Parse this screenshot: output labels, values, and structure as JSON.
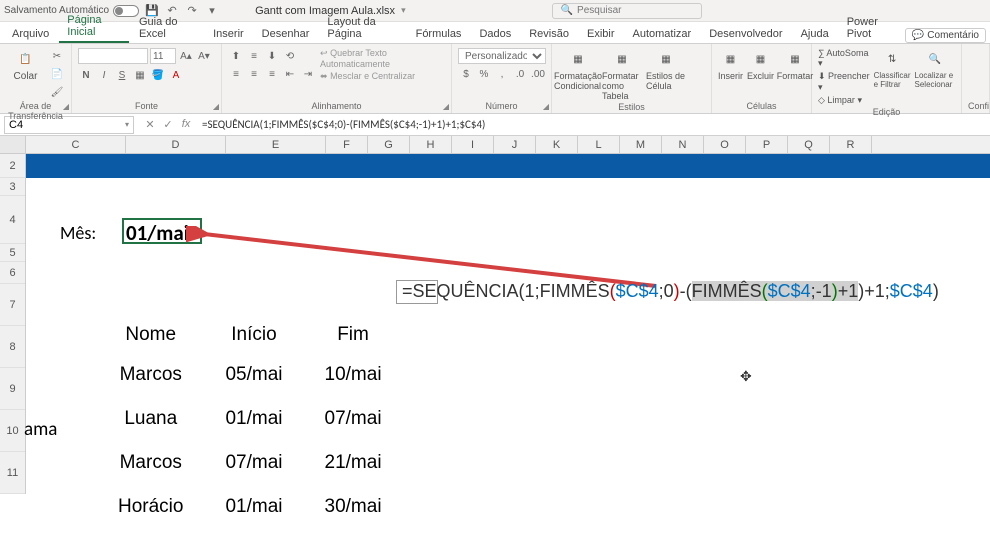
{
  "titlebar": {
    "autosave": "Salvamento Automático",
    "filename": "Gantt com Imagem Aula.xlsx",
    "search_placeholder": "Pesquisar"
  },
  "tabs": {
    "file": "Arquivo",
    "home": "Página Inicial",
    "excel_guide": "Guia do Excel",
    "insert": "Inserir",
    "draw": "Desenhar",
    "page_layout": "Layout da Página",
    "formulas": "Fórmulas",
    "data": "Dados",
    "review": "Revisão",
    "view": "Exibir",
    "automate": "Automatizar",
    "developer": "Desenvolvedor",
    "help": "Ajuda",
    "power_pivot": "Power Pivot",
    "comments": "Comentário"
  },
  "ribbon": {
    "clipboard": {
      "paste": "Colar",
      "group": "Área de Transferência"
    },
    "font": {
      "group": "Fonte",
      "size": "11"
    },
    "alignment": {
      "wrap": "Quebrar Texto Automaticamente",
      "merge": "Mesclar e Centralizar",
      "group": "Alinhamento"
    },
    "number": {
      "format": "Personalizado",
      "group": "Número"
    },
    "styles": {
      "cond": "Formatação Condicional",
      "table": "Formatar como Tabela",
      "cell": "Estilos de Célula",
      "group": "Estilos"
    },
    "cells": {
      "insert": "Inserir",
      "delete": "Excluir",
      "format": "Formatar",
      "group": "Células"
    },
    "editing": {
      "autosum": "AutoSoma",
      "fill": "Preencher",
      "clear": "Limpar",
      "sort": "Classificar e Filtrar",
      "find": "Localizar e Selecionar",
      "group": "Edição"
    },
    "conf": {
      "group": "Confi"
    }
  },
  "formula_bar": {
    "name_box": "C4",
    "formula": "=SEQUÊNCIA(1;FIMMÊS($C$4;0)-(FIMMÊS($C$4;-1)+1)+1;$C$4)"
  },
  "columns": [
    "C",
    "D",
    "E",
    "F",
    "G",
    "H",
    "I",
    "J",
    "K",
    "L",
    "M",
    "N",
    "O",
    "P",
    "Q",
    "R"
  ],
  "row_numbers": [
    "2",
    "3",
    "4",
    "5",
    "6",
    "7",
    "8",
    "9",
    "10",
    "11"
  ],
  "sheet": {
    "mes_label": "Mês:",
    "mes_value": "01/mai",
    "ama": "ama",
    "table_headers": [
      "Nome",
      "Início",
      "Fim"
    ],
    "rows": [
      [
        "Marcos",
        "05/mai",
        "10/mai"
      ],
      [
        "Luana",
        "01/mai",
        "07/mai"
      ],
      [
        "Marcos",
        "07/mai",
        "21/mai"
      ],
      [
        "Horácio",
        "01/mai",
        "30/mai"
      ]
    ]
  },
  "formula_display": {
    "eq": "=",
    "seq": "SEQUÊNCIA",
    "lp": "(",
    "one": "1",
    "sc": ";",
    "fimmes": "FIMMÊS",
    "ref": "$C$4",
    "zero": "0",
    "rp": ")",
    "minus": "-(",
    "neg1": "-1",
    "plus1": "+1",
    "final_plus1": "+1"
  }
}
